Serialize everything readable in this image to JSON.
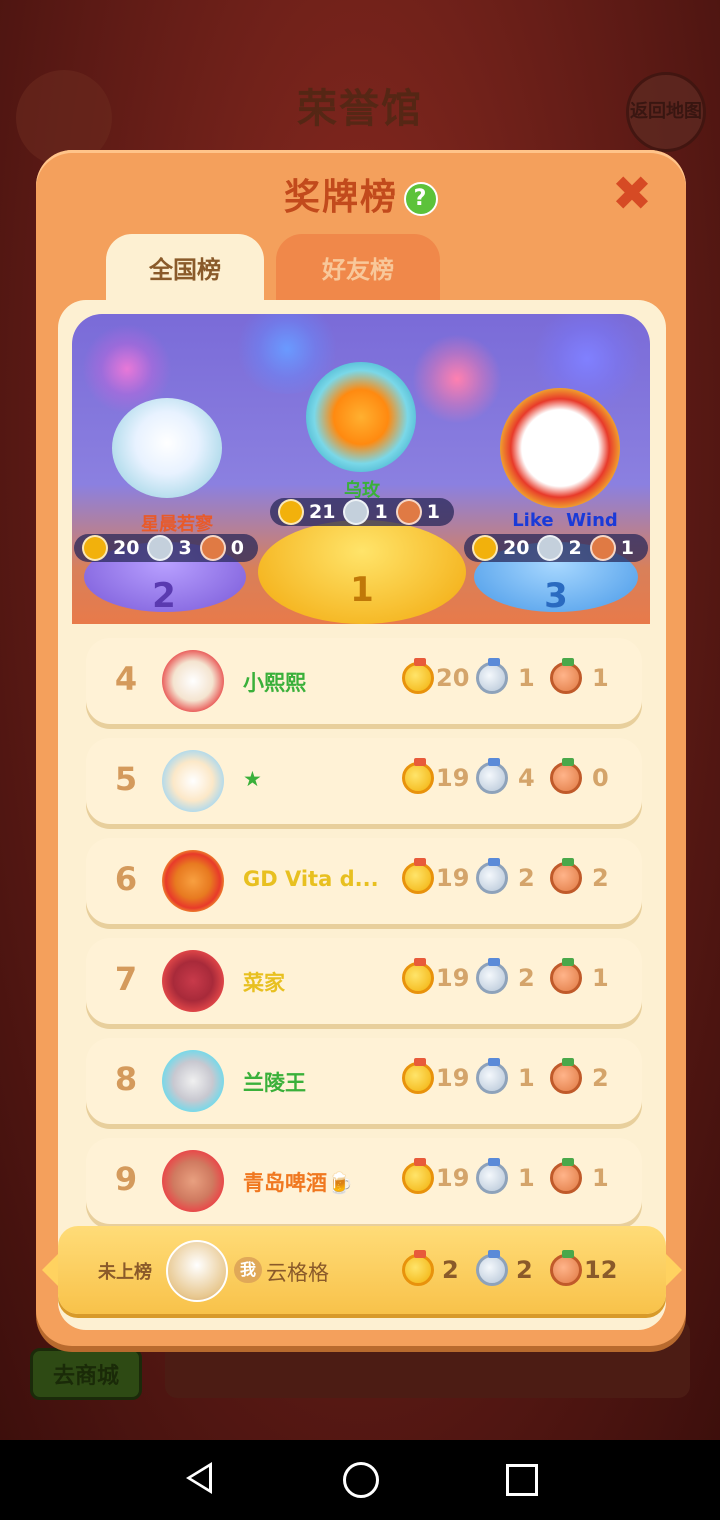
{
  "background": {
    "title": "荣誉馆",
    "back_label": "返回地图",
    "shop_button": "去商城"
  },
  "modal": {
    "title": "奖牌榜",
    "tabs": [
      {
        "label": "全国榜",
        "active": true
      },
      {
        "label": "好友榜",
        "active": false
      }
    ]
  },
  "podium": [
    {
      "rank": "2",
      "name": "星晨若寥",
      "name_color": "#e85a2a",
      "gold": "20",
      "silver": "3",
      "bronze": "0"
    },
    {
      "rank": "1",
      "name": "乌玫",
      "name_color": "#3ab03a",
      "gold": "21",
      "silver": "1",
      "bronze": "1"
    },
    {
      "rank": "3",
      "name": "Like  Wind",
      "name_color": "#1a3ad8",
      "gold": "20",
      "silver": "2",
      "bronze": "1"
    }
  ],
  "rows": [
    {
      "rank": "4",
      "name": "小熙熙",
      "name_color": "#3ab03a",
      "gold": "20",
      "silver": "1",
      "bronze": "1"
    },
    {
      "rank": "5",
      "name": "★",
      "name_color": "#3ab03a",
      "gold": "19",
      "silver": "4",
      "bronze": "0"
    },
    {
      "rank": "6",
      "name": "GD Vita d...",
      "name_color": "#e8c020",
      "gold": "19",
      "silver": "2",
      "bronze": "2"
    },
    {
      "rank": "7",
      "name": "菜家",
      "name_color": "#e8c020",
      "gold": "19",
      "silver": "2",
      "bronze": "1"
    },
    {
      "rank": "8",
      "name": "兰陵王",
      "name_color": "#3ab03a",
      "gold": "19",
      "silver": "1",
      "bronze": "2"
    },
    {
      "rank": "9",
      "name": "青岛啤酒🍺",
      "name_color": "#f07820",
      "gold": "19",
      "silver": "1",
      "bronze": "1"
    }
  ],
  "my_row": {
    "status": "未上榜",
    "me_badge": "我",
    "name": "云格格",
    "gold": "2",
    "silver": "2",
    "bronze": "12"
  },
  "colors": {
    "modal_bg": "#f4a05c",
    "panel_bg": "#fdf0d2",
    "title": "#c24a1c"
  }
}
